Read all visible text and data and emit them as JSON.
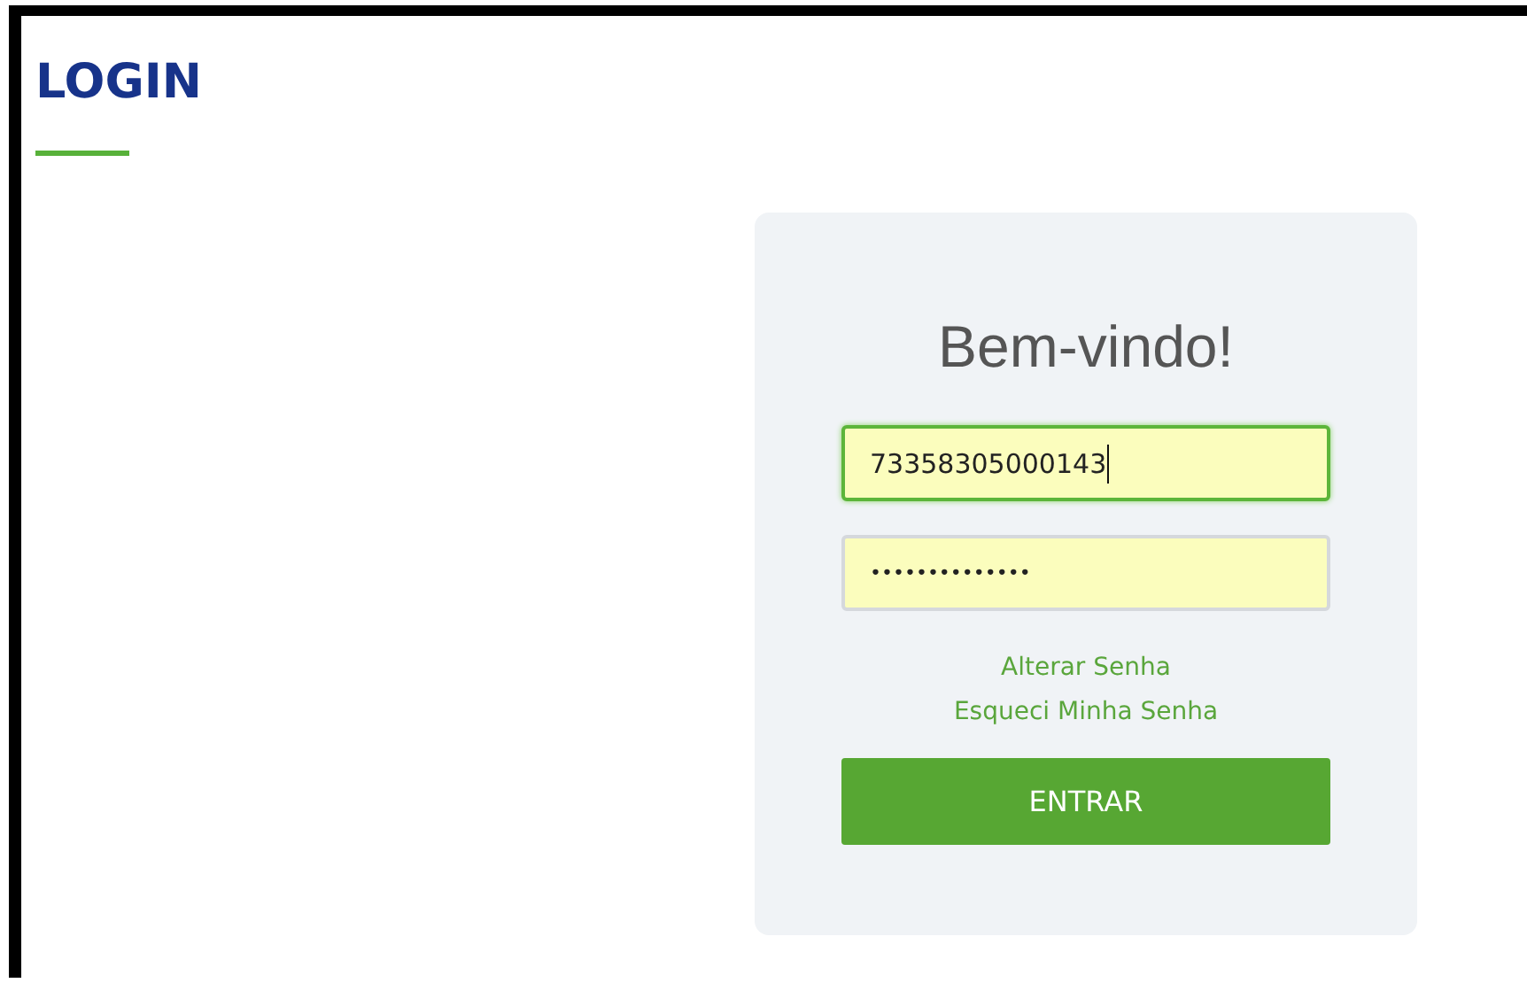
{
  "page": {
    "title": "LOGIN"
  },
  "login_card": {
    "heading": "Bem-vindo!",
    "fields": [
      {
        "kind": "text",
        "value": "73358305000143",
        "focused": true
      },
      {
        "kind": "password",
        "value": "••••••••••••••",
        "focused": false
      }
    ],
    "links": [
      "Alterar Senha",
      "Esqueci Minha Senha"
    ],
    "submit_button": "ENTRAR"
  }
}
